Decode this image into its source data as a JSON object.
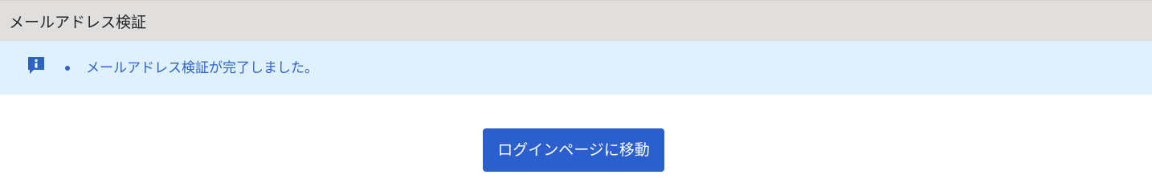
{
  "header": {
    "title": "メールアドレス検証"
  },
  "alert": {
    "icon": "info-icon",
    "messages": [
      "メールアドレス検証が完了しました。"
    ]
  },
  "actions": {
    "login_label": "ログインページに移動"
  },
  "colors": {
    "header_bg": "#e0dfdd",
    "alert_bg": "#dff0fe",
    "alert_text": "#2e63c6",
    "button_bg": "#2b5fcd",
    "button_text": "#ffffff"
  }
}
